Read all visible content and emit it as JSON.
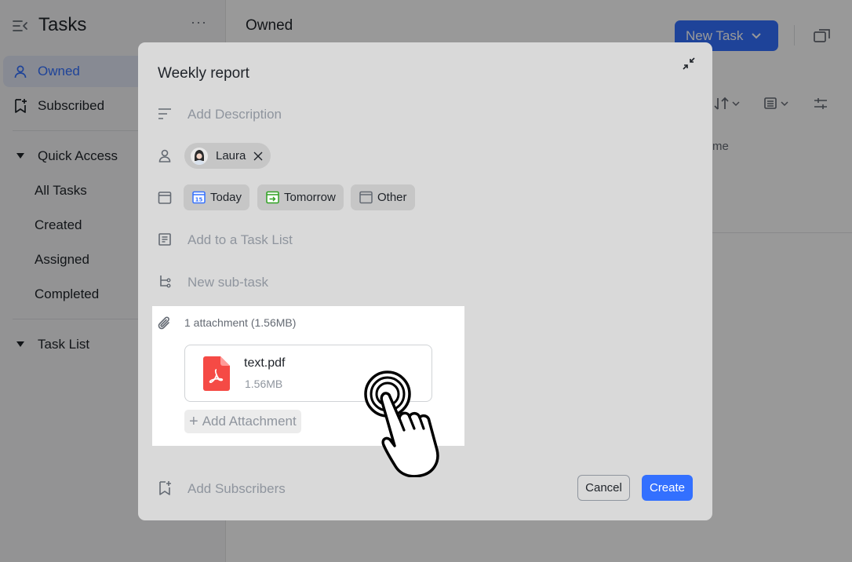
{
  "sidebar": {
    "title": "Tasks",
    "more": "···",
    "items": [
      {
        "label": "Owned"
      },
      {
        "label": "Subscribed"
      }
    ],
    "quick_access": {
      "label": "Quick Access",
      "items": [
        {
          "label": "All Tasks"
        },
        {
          "label": "Created"
        },
        {
          "label": "Assigned"
        },
        {
          "label": "Completed"
        }
      ]
    },
    "task_list": {
      "label": "Task List"
    }
  },
  "main": {
    "title": "Owned",
    "new_task_label": "New Task",
    "column_partial": "me"
  },
  "modal": {
    "title": "Weekly report",
    "description_placeholder": "Add Description",
    "assignee": {
      "name": "Laura"
    },
    "due_chips": [
      {
        "label": "Today",
        "icon": "calendar-15-icon",
        "color": "#3370ff"
      },
      {
        "label": "Tomorrow",
        "icon": "arrow-right-box-icon",
        "color": "#2ea121"
      },
      {
        "label": "Other",
        "icon": "calendar-icon",
        "color": "#646a73"
      }
    ],
    "task_list_placeholder": "Add to a Task List",
    "subtask_placeholder": "New sub-task",
    "attachments": {
      "count_label": "1 attachment (1.56MB)",
      "files": [
        {
          "name": "text.pdf",
          "size": "1.56MB",
          "icon": "pdf-icon",
          "color": "#f54a45"
        }
      ],
      "add_label": "Add Attachment"
    },
    "subscribers_placeholder": "Add Subscribers",
    "cancel_label": "Cancel",
    "create_label": "Create"
  },
  "colors": {
    "accent": "#3370ff",
    "pdf": "#f54a45"
  }
}
